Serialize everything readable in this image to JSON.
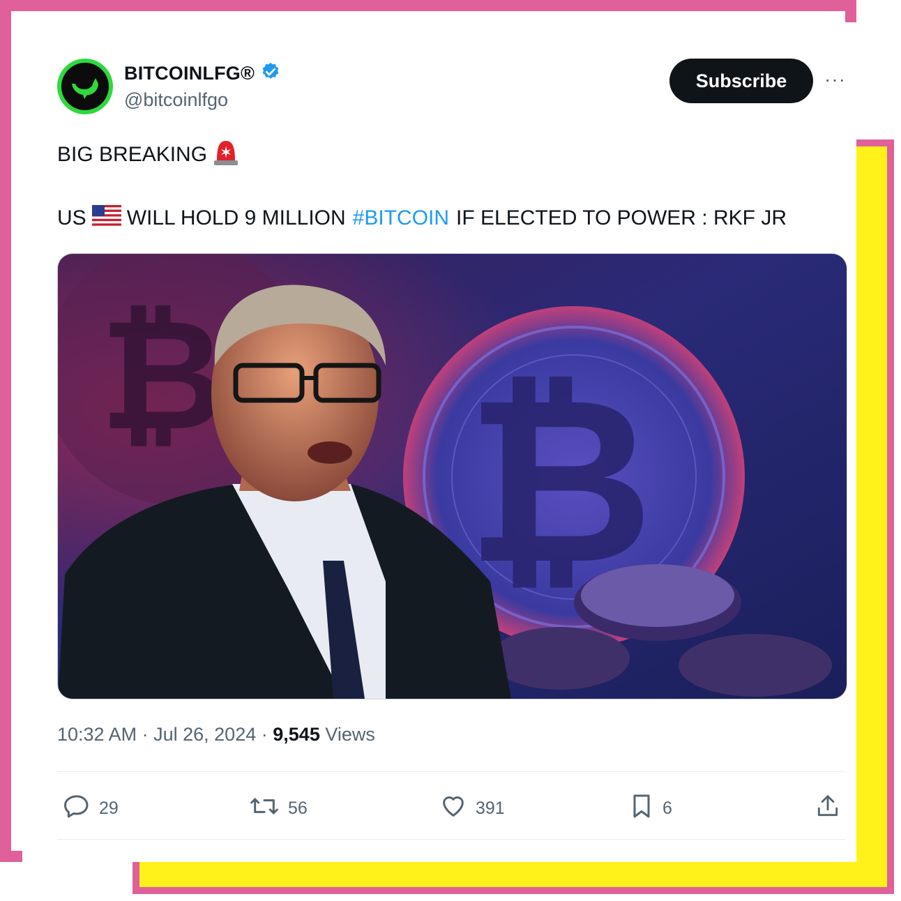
{
  "account": {
    "display_name": "BITCOINLFG®",
    "handle": "@bitcoinlfgo",
    "verified": true,
    "avatar_icon": "whale-logo-icon"
  },
  "header": {
    "subscribe_label": "Subscribe",
    "more_label": "···"
  },
  "tweet": {
    "line1_text": "BIG BREAKING",
    "line1_emoji": "police-light-emoji",
    "line2_prefix": "US",
    "line2_flag": "us-flag-emoji",
    "line2_mid": "WILL HOLD 9 MILLION",
    "hashtag": "#BITCOIN",
    "line2_suffix": "IF ELECTED TO POWER : RKF JR"
  },
  "media": {
    "description_icon": "bitcoin-photo"
  },
  "meta": {
    "time": "10:32 AM",
    "sep1": "·",
    "date": "Jul 26, 2024",
    "sep2": "·",
    "views_count": "9,545",
    "views_label": "Views"
  },
  "actions": {
    "replies": "29",
    "reposts": "56",
    "likes": "391",
    "bookmarks": "6"
  },
  "colors": {
    "frame_pink": "#e0609a",
    "frame_yellow": "#fff21a",
    "link_blue": "#1d9bf0",
    "avatar_green": "#2fd93c"
  }
}
